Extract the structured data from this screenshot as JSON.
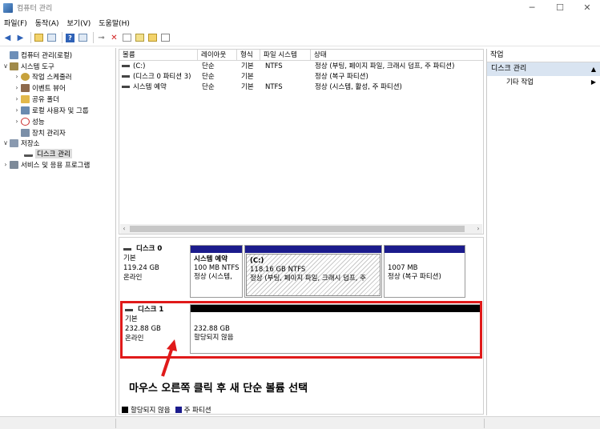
{
  "window": {
    "title": "컴퓨터 관리"
  },
  "menu": [
    "파일(F)",
    "동작(A)",
    "보기(V)",
    "도움말(H)"
  ],
  "tree": [
    {
      "label": "컴퓨터 관리(로컬)",
      "arrow": "",
      "icon": "computer-management-icon",
      "color": "#6d8fb8"
    },
    {
      "label": "시스템 도구",
      "arrow": "∨",
      "icon": "system-tools-icon",
      "color": "#a08a4a"
    },
    {
      "label": "작업 스케줄러",
      "arrow": "›",
      "icon": "clock-icon",
      "color": "#c7a23d"
    },
    {
      "label": "이벤트 뷰어",
      "arrow": "›",
      "icon": "event-viewer-icon",
      "color": "#8e6a4c"
    },
    {
      "label": "공유 폴더",
      "arrow": "›",
      "icon": "folder-icon",
      "color": "#e2b84a"
    },
    {
      "label": "로컬 사용자 및 그룹",
      "arrow": "›",
      "icon": "users-icon",
      "color": "#6a8bb0"
    },
    {
      "label": "성능",
      "arrow": "›",
      "icon": "no-entry-icon",
      "color": "#c33"
    },
    {
      "label": "장치 관리자",
      "arrow": "",
      "icon": "device-manager-icon",
      "color": "#7b8fa8"
    },
    {
      "label": "저장소",
      "arrow": "∨",
      "icon": "storage-icon",
      "color": "#8a9ab0"
    },
    {
      "label": "디스크 관리",
      "arrow": "",
      "icon": "disk-icon",
      "color": "#555"
    },
    {
      "label": "서비스 및 응용 프로그램",
      "arrow": "›",
      "icon": "services-icon",
      "color": "#7d8a99"
    }
  ],
  "volume_list": {
    "columns": [
      "볼륨",
      "레이아웃",
      "형식",
      "파일 시스템",
      "상태"
    ],
    "rows": [
      {
        "volume": "(C:)",
        "layout": "단순",
        "type": "기본",
        "fs": "NTFS",
        "status": "정상 (부팅, 페이지 파일, 크래시 덤프, 주 파티션)"
      },
      {
        "volume": "(디스크 0 파티션 3)",
        "layout": "단순",
        "type": "기본",
        "fs": "",
        "status": "정상 (복구 파티션)"
      },
      {
        "volume": "시스템 예약",
        "layout": "단순",
        "type": "기본",
        "fs": "NTFS",
        "status": "정상 (시스템, 활성, 주 파티션)"
      }
    ]
  },
  "disks": [
    {
      "name": "디스크 0",
      "kind": "기본",
      "size": "119.24 GB",
      "state": "온라인",
      "partitions": [
        {
          "name": "시스템 예약",
          "line1": "100 MB NTFS",
          "line2": "정상 (시스템,"
        },
        {
          "name": "(C:)",
          "line1": "118.16 GB NTFS",
          "line2": "정상 (부팅, 페이지 파일, 크래시 덤프, 주"
        },
        {
          "name": "",
          "line1": "1007 MB",
          "line2": "정상 (복구 파티션)"
        }
      ]
    },
    {
      "name": "디스크 1",
      "kind": "기본",
      "size": "232.88 GB",
      "state": "온라인",
      "partitions": [
        {
          "name": "",
          "line1": "232.88 GB",
          "line2": "할당되지 않음"
        }
      ]
    }
  ],
  "legend": [
    {
      "label": "할당되지 않음",
      "color": "#000000"
    },
    {
      "label": "주 파티션",
      "color": "#1b1b8c"
    }
  ],
  "actions": {
    "header": "작업",
    "section": "디스크 관리",
    "item": "기타 작업"
  },
  "annotation": "마우스 오른쪽 클릭 후 새 단순 볼륨 선택",
  "colors": {
    "highlight": "#e01a1a",
    "primary_partition": "#1b1b8c",
    "unallocated": "#000000"
  }
}
